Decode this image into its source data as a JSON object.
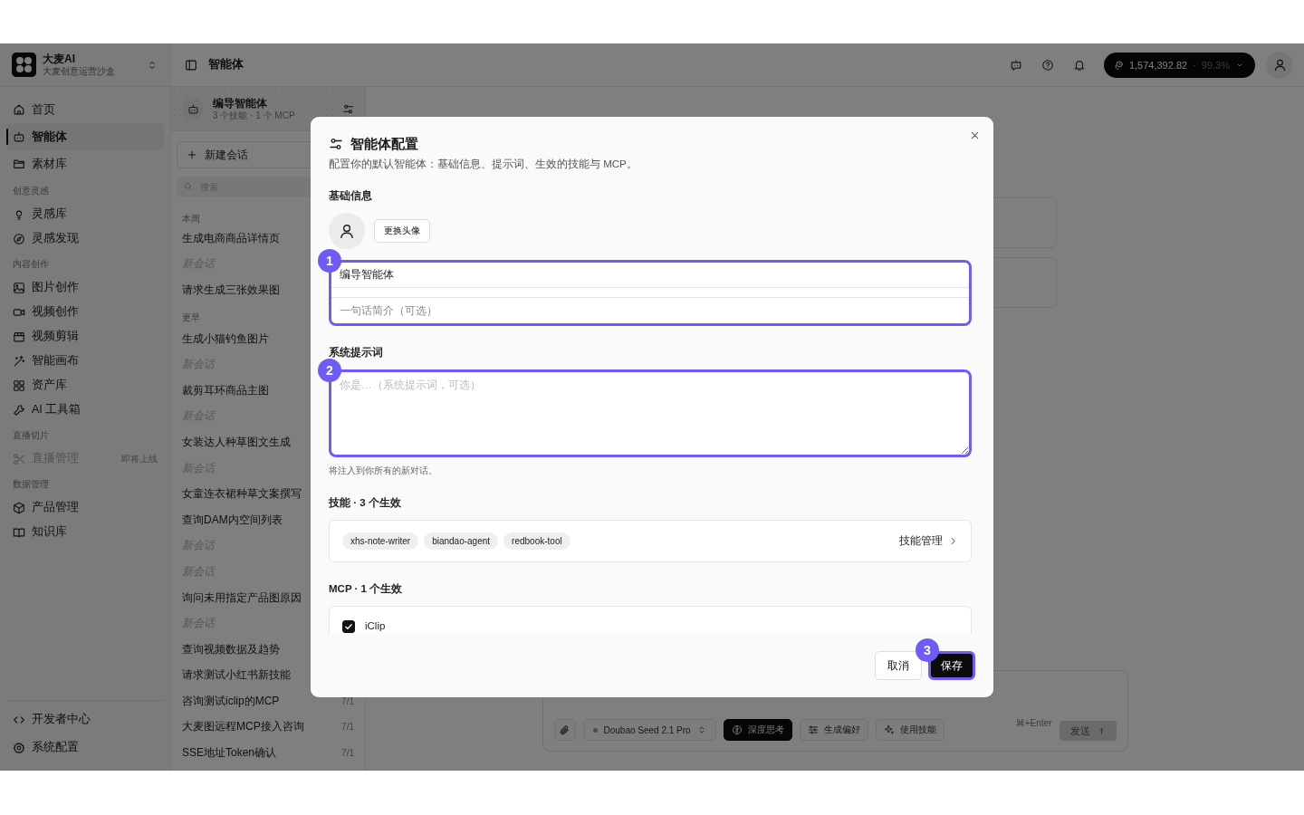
{
  "sidebar": {
    "brand": {
      "name": "大麦AI",
      "subtitle": "大麦创意运营沙盒"
    },
    "sections": [
      {
        "items": [
          {
            "label": "首页",
            "selected": false,
            "disabled": false
          },
          {
            "label": "智能体",
            "selected": true,
            "disabled": false
          },
          {
            "label": "素材库",
            "selected": false,
            "disabled": false
          }
        ]
      },
      {
        "heading": "创意灵感",
        "items": [
          {
            "label": "灵感库",
            "selected": false,
            "disabled": false
          },
          {
            "label": "灵感发现",
            "selected": false,
            "disabled": false
          }
        ]
      },
      {
        "heading": "内容创作",
        "items": [
          {
            "label": "图片创作",
            "selected": false,
            "disabled": false
          },
          {
            "label": "视频创作",
            "selected": false,
            "disabled": false
          },
          {
            "label": "视频剪辑",
            "selected": false,
            "disabled": false
          },
          {
            "label": "智能画布",
            "selected": false,
            "disabled": false
          },
          {
            "label": "资产库",
            "selected": false,
            "disabled": false
          },
          {
            "label": "AI 工具箱",
            "selected": false,
            "disabled": false
          }
        ]
      },
      {
        "heading": "直播切片",
        "items": [
          {
            "label": "直播管理",
            "selected": false,
            "disabled": true,
            "badge": "即将上线"
          }
        ]
      },
      {
        "heading": "数据管理",
        "items": [
          {
            "label": "产品管理",
            "selected": false,
            "disabled": false
          },
          {
            "label": "知识库",
            "selected": false,
            "disabled": false
          }
        ]
      }
    ],
    "footer_items": [
      {
        "label": "开发者中心"
      },
      {
        "label": "系统配置"
      }
    ]
  },
  "topbar": {
    "title": "智能体",
    "credits": {
      "amount": "1,574,392.82",
      "separator": "·",
      "percent": "99.3%"
    }
  },
  "agent_panel": {
    "name": "编导智能体",
    "summary": "3 个技能 · 1 个 MCP",
    "new_chat_button": "新建会话",
    "search": {
      "placeholder": "搜索"
    },
    "groups": [
      {
        "heading": "本周",
        "chats": [
          {
            "title": "生成电商商品详情页",
            "untitled": false
          },
          {
            "title": "新会话",
            "untitled": true
          },
          {
            "title": "请求生成三张效果图",
            "untitled": false
          }
        ]
      },
      {
        "heading": "更早",
        "chats": [
          {
            "title": "生成小猫钓鱼图片",
            "untitled": false
          },
          {
            "title": "新会话",
            "untitled": true
          },
          {
            "title": "裁剪耳环商品主图",
            "untitled": false
          },
          {
            "title": "新会话",
            "untitled": true
          },
          {
            "title": "女装达人种草图文生成",
            "untitled": false
          },
          {
            "title": "新会话",
            "untitled": true
          },
          {
            "title": "女童连衣裙种草文案撰写",
            "untitled": false
          },
          {
            "title": "查询DAM内空间列表",
            "untitled": false
          },
          {
            "title": "新会话",
            "untitled": true
          },
          {
            "title": "新会话",
            "untitled": true
          },
          {
            "title": "询问未用指定产品图原因",
            "untitled": false
          },
          {
            "title": "新会话",
            "untitled": true
          },
          {
            "title": "查询视频数据及趋势",
            "untitled": false
          },
          {
            "title": "请求测试小红书新技能",
            "untitled": false
          },
          {
            "title": "咨询测试iclip的MCP",
            "untitled": false,
            "date": "7/1"
          },
          {
            "title": "大麦图远程MCP接入咨询",
            "untitled": false,
            "date": "7/1"
          },
          {
            "title": "SSE地址Token确认",
            "untitled": false,
            "date": "7/1"
          }
        ]
      }
    ]
  },
  "composer": {
    "model": "Doubao Seed 2.1 Pro",
    "tools": [
      {
        "label": "深度思考",
        "on": true
      },
      {
        "label": "生成偏好",
        "on": false
      },
      {
        "label": "使用技能",
        "on": false
      }
    ],
    "shortcut": "⌘+Enter",
    "send_button": {
      "label": "发送",
      "disabled": true
    }
  },
  "dialog": {
    "title": "智能体配置",
    "description": "配置你的默认智能体：基础信息、提示词、生效的技能与 MCP。",
    "basic_section": {
      "heading": "基础信息",
      "change_avatar_button": "更换头像",
      "callout": "1",
      "name_field": {
        "value": "编导智能体"
      },
      "summary_field": {
        "placeholder": "一句话简介（可选）"
      }
    },
    "prompt_section": {
      "heading": "系统提示词",
      "callout": "2",
      "prompt_field": {
        "placeholder": "你是…（系统提示词，可选）"
      },
      "hint": "将注入到你所有的新对话。"
    },
    "skills_section": {
      "heading": "技能 · 3 个生效",
      "skills": [
        "xhs-note-writer",
        "biandao-agent",
        "redbook-tool"
      ],
      "manage_link": "技能管理"
    },
    "mcp_section": {
      "heading": "MCP · 1 个生效",
      "servers": [
        {
          "name": "iClip",
          "checked": true
        }
      ]
    },
    "buttons": {
      "cancel": "取消",
      "save": "保存",
      "save_callout": "3"
    }
  }
}
